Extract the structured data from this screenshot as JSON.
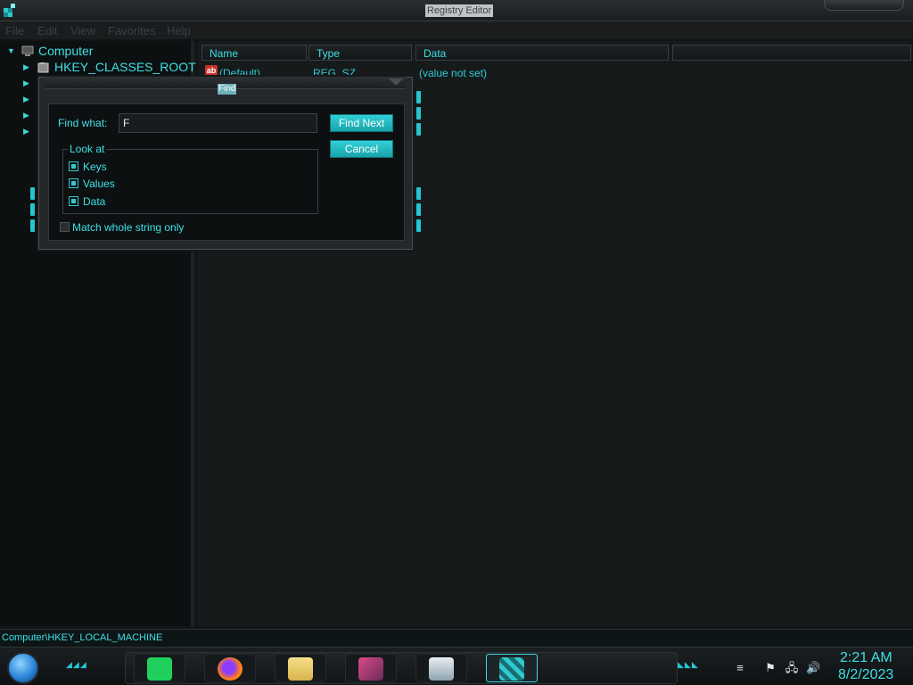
{
  "window": {
    "title": "Registry Editor"
  },
  "menu": [
    "File",
    "Edit",
    "View",
    "Favorites",
    "Help"
  ],
  "tree": {
    "root": "Computer",
    "items": [
      "HKEY_CLASSES_ROOT"
    ]
  },
  "list": {
    "columns": [
      "Name",
      "Type",
      "Data"
    ],
    "rows": [
      {
        "name": "(Default)",
        "type": "REG_SZ",
        "data": "(value not set)",
        "icon": "string-value-icon"
      }
    ]
  },
  "find_dialog": {
    "title": "Find",
    "find_what_label": "Find what:",
    "find_what_value": "F",
    "find_next_label": "Find Next",
    "cancel_label": "Cancel",
    "look_at_label": "Look at",
    "options": [
      {
        "label": "Keys",
        "checked": true
      },
      {
        "label": "Values",
        "checked": true
      },
      {
        "label": "Data",
        "checked": true
      }
    ],
    "match_whole_label": "Match whole string only",
    "match_whole_checked": false
  },
  "status": {
    "path": "Computer\\HKEY_LOCAL_MACHINE"
  },
  "taskbar": {
    "apps": [
      "notes-app-icon",
      "firefox-icon",
      "file-explorer-icon",
      "screen-app-icon",
      "network-app-icon",
      "registry-editor-icon"
    ],
    "time": "2:21 AM",
    "date": "8/2/2023"
  },
  "colors": {
    "accent": "#3de0e6",
    "background": "#111516"
  }
}
